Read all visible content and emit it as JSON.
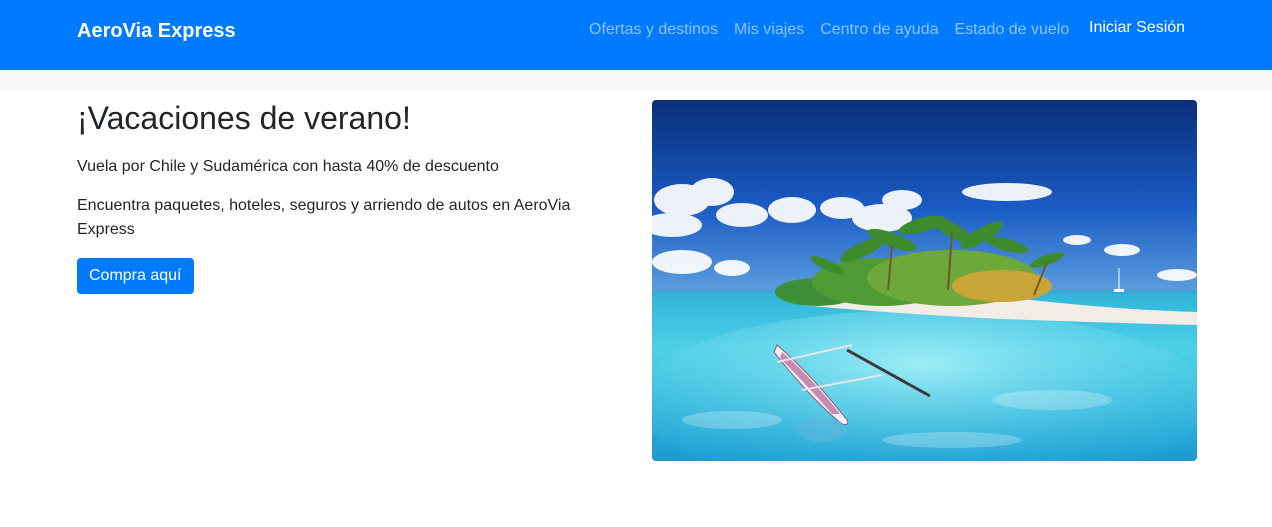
{
  "navbar": {
    "brand": "AeroVia Express",
    "links": [
      {
        "label": "Ofertas y destinos"
      },
      {
        "label": "Mis viajes"
      },
      {
        "label": "Centro de ayuda"
      },
      {
        "label": "Estado de vuelo"
      }
    ],
    "login": "Iniciar Sesión"
  },
  "hero": {
    "title": "¡Vacaciones de verano!",
    "subtitle": "Vuela por Chile y Sudamérica con hasta 40% de descuento",
    "description": "Encuentra paquetes, hoteles, seguros y arriendo de autos en AeroVia Express",
    "cta": "Compra aquí"
  },
  "colors": {
    "primary": "#007bff",
    "text": "#212529"
  }
}
